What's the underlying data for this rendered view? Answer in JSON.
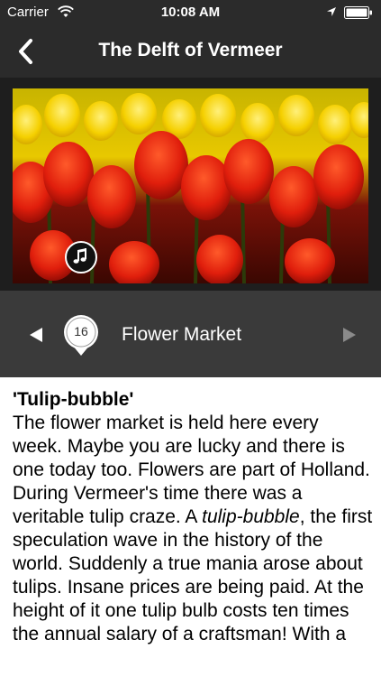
{
  "status_bar": {
    "carrier": "Carrier",
    "time": "10:08 AM",
    "icons": [
      "wifi-icon",
      "location-icon",
      "battery-icon"
    ]
  },
  "nav": {
    "title": "The Delft of Vermeer",
    "back_icon": "chevron-left-icon"
  },
  "hero": {
    "image_subject": "red and yellow tulips",
    "audio_icon": "music-note-icon"
  },
  "stop": {
    "number": "16",
    "name": "Flower Market",
    "prev_icon": "triangle-left-icon",
    "next_icon": "triangle-right-icon"
  },
  "content": {
    "heading": "'Tulip-bubble'",
    "body_1": "The flower market is held here every week. Maybe you are lucky and there is one today too. Flowers are part of Holland. During Vermeer's time there was a veritable tulip craze. A ",
    "body_italic": "tulip-bubble",
    "body_2": ", the first speculation wave in the history of the world. Suddenly a true mania arose about tulips. Insane prices are being paid. At the height of it one tulip bulb costs ten times the annual salary of a craftsman! With a"
  },
  "colors": {
    "bar_dark": "#2b2b2b",
    "stop_bar": "#3a3a3a",
    "text": "#000000",
    "tulip_red": "#d81f10",
    "tulip_yellow": "#f2c400"
  }
}
